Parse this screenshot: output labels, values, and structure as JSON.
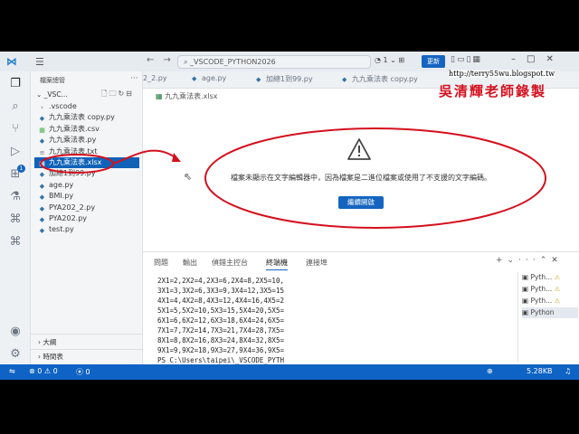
{
  "titlebar": {
    "logo_icon": "vscode-logo-icon",
    "menu_icon": "hamburger-menu-icon",
    "search_text": "_VSCODE_PYTHON2026",
    "account_count": "1",
    "update_label": "更新"
  },
  "activity": {
    "items": [
      "explorer-icon",
      "search-icon",
      "source-control-icon",
      "run-debug-icon",
      "extensions-icon",
      "testing-icon",
      "python-icon",
      "python-env-icon"
    ],
    "extensions_badge": "1"
  },
  "sidebar": {
    "title": "檔案總管",
    "folder": "_VSC...",
    "files": [
      {
        "name": ".vscode",
        "icon": "folder-chevron-icon",
        "color": "#666666"
      },
      {
        "name": "九九乘法表 copy.py",
        "icon": "python-file-icon",
        "color": "#3572A5"
      },
      {
        "name": "九九乘法表.csv",
        "icon": "csv-file-icon",
        "color": "#4caf50"
      },
      {
        "name": "九九乘法表.py",
        "icon": "python-file-icon",
        "color": "#3572A5"
      },
      {
        "name": "九九乘法表.txt",
        "icon": "text-file-icon",
        "color": "#777777"
      },
      {
        "name": "九九乘法表.xlsx",
        "icon": "excel-file-icon",
        "color": "#1e7b3a"
      },
      {
        "name": "加總1到99.py",
        "icon": "python-file-icon",
        "color": "#3572A5"
      },
      {
        "name": "age.py",
        "icon": "python-file-icon",
        "color": "#3572A5"
      },
      {
        "name": "BMI.py",
        "icon": "python-file-icon",
        "color": "#3572A5"
      },
      {
        "name": "PYA202_2.py",
        "icon": "python-file-icon",
        "color": "#3572A5"
      },
      {
        "name": "PYA202.py",
        "icon": "python-file-icon",
        "color": "#3572A5"
      },
      {
        "name": "test.py",
        "icon": "python-file-icon",
        "color": "#3572A5"
      }
    ],
    "outline_label": "大綱",
    "timeline_label": "時間表"
  },
  "tabs": [
    {
      "label": "2_2.py",
      "icon": "python-file-icon"
    },
    {
      "label": "age.py",
      "icon": "python-file-icon"
    },
    {
      "label": "加總1到99.py",
      "icon": "python-file-icon"
    },
    {
      "label": "九九乘法表 copy.py",
      "icon": "python-file-icon"
    }
  ],
  "watermark": {
    "blog_url": "http://terry55wu.blogspot.tw",
    "seal_text": "吳清輝老師錄製"
  },
  "editor": {
    "breadcrumb": "九九乘法表.xlsx",
    "message": "檔案未顯示在文字編輯器中，因為檔案是二進位檔案或使用了不支援的文字編碼。",
    "open_anyway_label": "繼續開啟"
  },
  "panel": {
    "tabs": [
      "問題",
      "輸出",
      "偵錯主控台",
      "終端機",
      "連接埠"
    ],
    "active_tab": "終端機",
    "terminal_lines": [
      "2X1=2,2X2=4,2X3=6,2X4=8,2X5=10,",
      "3X1=3,3X2=6,3X3=9,3X4=12,3X5=15",
      "4X1=4,4X2=8,4X3=12,4X4=16,4X5=2",
      "5X1=5,5X2=10,5X3=15,5X4=20,5X5=",
      "6X1=6,6X2=12,6X3=18,6X4=24,6X5=",
      "7X1=7,7X2=14,7X3=21,7X4=28,7X5=",
      "8X1=8,8X2=16,8X3=24,8X4=32,8X5=",
      "9X1=9,9X2=18,9X3=27,9X4=36,9X5=",
      "PS C:\\Users\\taipei\\_VSCODE_PYTH"
    ],
    "terminals": [
      "Pyth...",
      "Pyth...",
      "Pyth...",
      "Python"
    ]
  },
  "statusbar": {
    "errors": "0",
    "warnings": "0",
    "file_size": "5.28KB"
  },
  "colors": {
    "accent": "#1565c0",
    "statusbar": "#0f63c4",
    "annotation_red": "#d4101e"
  }
}
